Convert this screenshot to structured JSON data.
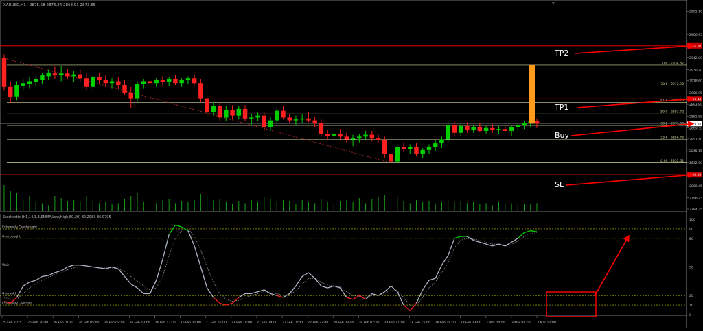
{
  "window": {
    "title": "XAUUSD,H1",
    "ohlc": "2875.58 2876.24 2868.91 2873.65"
  },
  "stoch_title": "Stochastic (H1,14,3,3,SMMA,Low/High,80,20) 82.2983 86.9795",
  "colors": {
    "background": "#000000",
    "bull": "#00d000",
    "bear": "#ff2020",
    "fib": "#d8d8a0",
    "red_level": "#ff0000",
    "volume": "#1aa01a",
    "stoch_main": "#b0b8c8",
    "stoch_signal": "#909090",
    "stoch_level": "#c8c800",
    "orange_bar": "#ff9a1a",
    "axis_text": "#c0c0c0",
    "annotation": "#ffffff",
    "arrow": "#ff0000"
  },
  "price_axis_labels": [
    "2991.10",
    "2966.95",
    "2942.80",
    "2930.20",
    "2918.60",
    "2906.05",
    "2893.80",
    "2881.55",
    "2869.30",
    "2857.40",
    "2845.15",
    "2832.90",
    "2808.45",
    "2796.25",
    "2784.25"
  ],
  "red_level_tags": {
    "tp2": "2955.00",
    "tp1": "2899.44",
    "sl": "2820.00"
  },
  "current_price_tag": "2873.65",
  "fib_levels": [
    {
      "label": "100 - 2934.82",
      "price": 2934.82
    },
    {
      "label": "78.6 - 2912.90",
      "price": 2912.9
    },
    {
      "label": "61.8 - 2895.76",
      "price": 2895.76
    },
    {
      "label": "50.0 - 2883.72",
      "price": 2883.72
    },
    {
      "label": "38.2 - 2871.69",
      "price": 2871.69
    },
    {
      "label": "23.6 - 2856.73",
      "price": 2856.73
    },
    {
      "label": "0.00 - 2832.61",
      "price": 2832.61
    }
  ],
  "annotations": {
    "tp2": "TP2",
    "tp1": "TP1",
    "buy": "Buy",
    "sl": "SL"
  },
  "stoch_levels": [
    {
      "label": "Extremely Overbought",
      "value": 90
    },
    {
      "label": "Overbought",
      "value": 80
    },
    {
      "label": "Wait",
      "value": 50
    },
    {
      "label": "Oversold",
      "value": 20
    },
    {
      "label": "Extremely Oversold",
      "value": 10
    }
  ],
  "stoch_axis_labels": [
    "100",
    "90",
    "80",
    "50",
    "20",
    "10",
    "0"
  ],
  "time_labels": [
    "25 Feb 2025",
    "25 Feb 20:00",
    "26 Feb 01:00",
    "26 Feb 05:00",
    "26 Feb 09:00",
    "26 Feb 13:00",
    "26 Feb 17:00",
    "26 Feb 21:00",
    "27 Feb 06:00",
    "27 Feb 10:00",
    "27 Feb 14:00",
    "27 Feb 18:00",
    "27 Feb 22:00",
    "28 Feb 03:00",
    "28 Feb 07:00",
    "28 Feb 11:00",
    "28 Feb 15:00",
    "28 Feb 19:00",
    "28 Feb 23:00",
    "3 Mar 04:00",
    "3 Mar 08:00",
    "3 Mar 12:00"
  ],
  "chart_data": {
    "type": "candlestick",
    "y_axis_range": [
      2784.25,
      2995
    ],
    "candles": [
      {
        "o": 2942,
        "h": 2946,
        "l": 2908,
        "c": 2912
      },
      {
        "o": 2912,
        "h": 2918,
        "l": 2895,
        "c": 2901
      },
      {
        "o": 2902,
        "h": 2918,
        "l": 2898,
        "c": 2914
      },
      {
        "o": 2913,
        "h": 2920,
        "l": 2908,
        "c": 2916
      },
      {
        "o": 2915,
        "h": 2922,
        "l": 2910,
        "c": 2918
      },
      {
        "o": 2917,
        "h": 2923,
        "l": 2912,
        "c": 2920
      },
      {
        "o": 2919,
        "h": 2927,
        "l": 2915,
        "c": 2924
      },
      {
        "o": 2923,
        "h": 2930,
        "l": 2919,
        "c": 2927
      },
      {
        "o": 2926,
        "h": 2933,
        "l": 2920,
        "c": 2924
      },
      {
        "o": 2924,
        "h": 2934,
        "l": 2918,
        "c": 2926
      },
      {
        "o": 2926,
        "h": 2931,
        "l": 2920,
        "c": 2923
      },
      {
        "o": 2923,
        "h": 2929,
        "l": 2917,
        "c": 2925
      },
      {
        "o": 2925,
        "h": 2930,
        "l": 2918,
        "c": 2921
      },
      {
        "o": 2921,
        "h": 2927,
        "l": 2909,
        "c": 2912
      },
      {
        "o": 2912,
        "h": 2925,
        "l": 2908,
        "c": 2922
      },
      {
        "o": 2922,
        "h": 2927,
        "l": 2915,
        "c": 2919
      },
      {
        "o": 2919,
        "h": 2924,
        "l": 2912,
        "c": 2916
      },
      {
        "o": 2916,
        "h": 2921,
        "l": 2910,
        "c": 2918
      },
      {
        "o": 2918,
        "h": 2922,
        "l": 2910,
        "c": 2914
      },
      {
        "o": 2914,
        "h": 2919,
        "l": 2904,
        "c": 2906
      },
      {
        "o": 2906,
        "h": 2912,
        "l": 2890,
        "c": 2900
      },
      {
        "o": 2900,
        "h": 2918,
        "l": 2896,
        "c": 2915
      },
      {
        "o": 2915,
        "h": 2920,
        "l": 2910,
        "c": 2918
      },
      {
        "o": 2918,
        "h": 2922,
        "l": 2913,
        "c": 2916
      },
      {
        "o": 2916,
        "h": 2921,
        "l": 2912,
        "c": 2919
      },
      {
        "o": 2919,
        "h": 2923,
        "l": 2914,
        "c": 2917
      },
      {
        "o": 2917,
        "h": 2922,
        "l": 2913,
        "c": 2920
      },
      {
        "o": 2920,
        "h": 2924,
        "l": 2914,
        "c": 2916
      },
      {
        "o": 2916,
        "h": 2921,
        "l": 2912,
        "c": 2919
      },
      {
        "o": 2919,
        "h": 2923,
        "l": 2915,
        "c": 2921
      },
      {
        "o": 2921,
        "h": 2924,
        "l": 2914,
        "c": 2916
      },
      {
        "o": 2916,
        "h": 2920,
        "l": 2896,
        "c": 2900
      },
      {
        "o": 2900,
        "h": 2904,
        "l": 2882,
        "c": 2886
      },
      {
        "o": 2886,
        "h": 2896,
        "l": 2882,
        "c": 2892
      },
      {
        "o": 2892,
        "h": 2896,
        "l": 2876,
        "c": 2880
      },
      {
        "o": 2880,
        "h": 2892,
        "l": 2876,
        "c": 2888
      },
      {
        "o": 2888,
        "h": 2893,
        "l": 2878,
        "c": 2882
      },
      {
        "o": 2882,
        "h": 2892,
        "l": 2878,
        "c": 2889
      },
      {
        "o": 2889,
        "h": 2893,
        "l": 2876,
        "c": 2879
      },
      {
        "o": 2879,
        "h": 2884,
        "l": 2872,
        "c": 2880
      },
      {
        "o": 2880,
        "h": 2885,
        "l": 2876,
        "c": 2882
      },
      {
        "o": 2882,
        "h": 2886,
        "l": 2866,
        "c": 2870
      },
      {
        "o": 2870,
        "h": 2880,
        "l": 2866,
        "c": 2877
      },
      {
        "o": 2877,
        "h": 2890,
        "l": 2873,
        "c": 2887
      },
      {
        "o": 2887,
        "h": 2892,
        "l": 2878,
        "c": 2880
      },
      {
        "o": 2880,
        "h": 2884,
        "l": 2874,
        "c": 2877
      },
      {
        "o": 2877,
        "h": 2882,
        "l": 2872,
        "c": 2878
      },
      {
        "o": 2878,
        "h": 2883,
        "l": 2874,
        "c": 2879
      },
      {
        "o": 2879,
        "h": 2886,
        "l": 2875,
        "c": 2877
      },
      {
        "o": 2877,
        "h": 2881,
        "l": 2870,
        "c": 2874
      },
      {
        "o": 2874,
        "h": 2878,
        "l": 2860,
        "c": 2863
      },
      {
        "o": 2863,
        "h": 2867,
        "l": 2856,
        "c": 2861
      },
      {
        "o": 2861,
        "h": 2866,
        "l": 2857,
        "c": 2863
      },
      {
        "o": 2863,
        "h": 2868,
        "l": 2857,
        "c": 2860
      },
      {
        "o": 2860,
        "h": 2864,
        "l": 2854,
        "c": 2857
      },
      {
        "o": 2857,
        "h": 2862,
        "l": 2850,
        "c": 2858
      },
      {
        "o": 2858,
        "h": 2863,
        "l": 2854,
        "c": 2860
      },
      {
        "o": 2860,
        "h": 2866,
        "l": 2856,
        "c": 2862
      },
      {
        "o": 2862,
        "h": 2866,
        "l": 2855,
        "c": 2858
      },
      {
        "o": 2858,
        "h": 2862,
        "l": 2854,
        "c": 2856
      },
      {
        "o": 2856,
        "h": 2860,
        "l": 2838,
        "c": 2842
      },
      {
        "o": 2842,
        "h": 2848,
        "l": 2830,
        "c": 2834
      },
      {
        "o": 2834,
        "h": 2852,
        "l": 2832,
        "c": 2849
      },
      {
        "o": 2849,
        "h": 2854,
        "l": 2844,
        "c": 2847
      },
      {
        "o": 2847,
        "h": 2852,
        "l": 2842,
        "c": 2849
      },
      {
        "o": 2849,
        "h": 2853,
        "l": 2840,
        "c": 2842
      },
      {
        "o": 2842,
        "h": 2848,
        "l": 2838,
        "c": 2846
      },
      {
        "o": 2846,
        "h": 2852,
        "l": 2842,
        "c": 2849
      },
      {
        "o": 2849,
        "h": 2856,
        "l": 2845,
        "c": 2853
      },
      {
        "o": 2853,
        "h": 2860,
        "l": 2848,
        "c": 2857
      },
      {
        "o": 2857,
        "h": 2876,
        "l": 2853,
        "c": 2872
      },
      {
        "o": 2872,
        "h": 2876,
        "l": 2860,
        "c": 2864
      },
      {
        "o": 2864,
        "h": 2874,
        "l": 2860,
        "c": 2871
      },
      {
        "o": 2871,
        "h": 2875,
        "l": 2864,
        "c": 2867
      },
      {
        "o": 2867,
        "h": 2872,
        "l": 2864,
        "c": 2870
      },
      {
        "o": 2870,
        "h": 2874,
        "l": 2865,
        "c": 2866
      },
      {
        "o": 2866,
        "h": 2871,
        "l": 2863,
        "c": 2869
      },
      {
        "o": 2869,
        "h": 2873,
        "l": 2864,
        "c": 2867
      },
      {
        "o": 2867,
        "h": 2871,
        "l": 2863,
        "c": 2868
      },
      {
        "o": 2868,
        "h": 2871,
        "l": 2864,
        "c": 2866
      },
      {
        "o": 2866,
        "h": 2872,
        "l": 2861,
        "c": 2870
      },
      {
        "o": 2870,
        "h": 2874,
        "l": 2866,
        "c": 2872
      },
      {
        "o": 2872,
        "h": 2876,
        "l": 2868,
        "c": 2874
      },
      {
        "o": 2874,
        "h": 2878,
        "l": 2870,
        "c": 2876
      },
      {
        "o": 2876,
        "h": 2879,
        "l": 2869,
        "c": 2873.65
      }
    ],
    "volumes": [
      52,
      40,
      36,
      22,
      30,
      18,
      16,
      12,
      30,
      26,
      20,
      22,
      18,
      30,
      24,
      16,
      18,
      14,
      16,
      24,
      30,
      36,
      18,
      20,
      16,
      22,
      24,
      16,
      20,
      18,
      22,
      34,
      30,
      22,
      24,
      18,
      14,
      20,
      16,
      22,
      18,
      28,
      24,
      18,
      22,
      20,
      14,
      22,
      18,
      16,
      24,
      18,
      16,
      20,
      22,
      18,
      26,
      16,
      24,
      28,
      32,
      34,
      28,
      20,
      16,
      22,
      18,
      20,
      14,
      18,
      22,
      18,
      20,
      16,
      18,
      14,
      16,
      12,
      18,
      14,
      16,
      12,
      14,
      14,
      16
    ],
    "stoch_main": [
      14,
      12,
      18,
      30,
      34,
      36,
      40,
      41,
      44,
      46,
      50,
      52,
      52,
      51,
      50,
      49,
      48,
      50,
      48,
      40,
      32,
      28,
      22,
      22,
      36,
      58,
      84,
      94,
      92,
      88,
      72,
      50,
      28,
      18,
      12,
      10,
      12,
      18,
      22,
      22,
      24,
      26,
      22,
      20,
      18,
      22,
      30,
      40,
      44,
      38,
      30,
      28,
      30,
      28,
      18,
      16,
      20,
      16,
      22,
      20,
      24,
      30,
      24,
      10,
      4,
      12,
      26,
      36,
      38,
      52,
      62,
      80,
      82,
      82,
      78,
      76,
      74,
      72,
      74,
      72,
      76,
      80,
      86,
      88,
      87
    ],
    "stoch_signal": [
      18,
      16,
      16,
      22,
      28,
      32,
      36,
      39,
      42,
      44,
      47,
      49,
      50,
      50,
      50,
      49,
      49,
      49,
      48,
      45,
      40,
      35,
      30,
      26,
      28,
      40,
      62,
      80,
      88,
      90,
      82,
      68,
      50,
      34,
      22,
      16,
      14,
      15,
      18,
      20,
      22,
      24,
      23,
      22,
      20,
      21,
      25,
      32,
      38,
      38,
      34,
      31,
      30,
      29,
      24,
      20,
      19,
      18,
      20,
      20,
      22,
      26,
      25,
      18,
      10,
      10,
      18,
      28,
      34,
      44,
      54,
      70,
      78,
      80,
      79,
      78,
      76,
      74,
      74,
      73,
      74,
      77,
      82,
      85,
      86
    ]
  }
}
